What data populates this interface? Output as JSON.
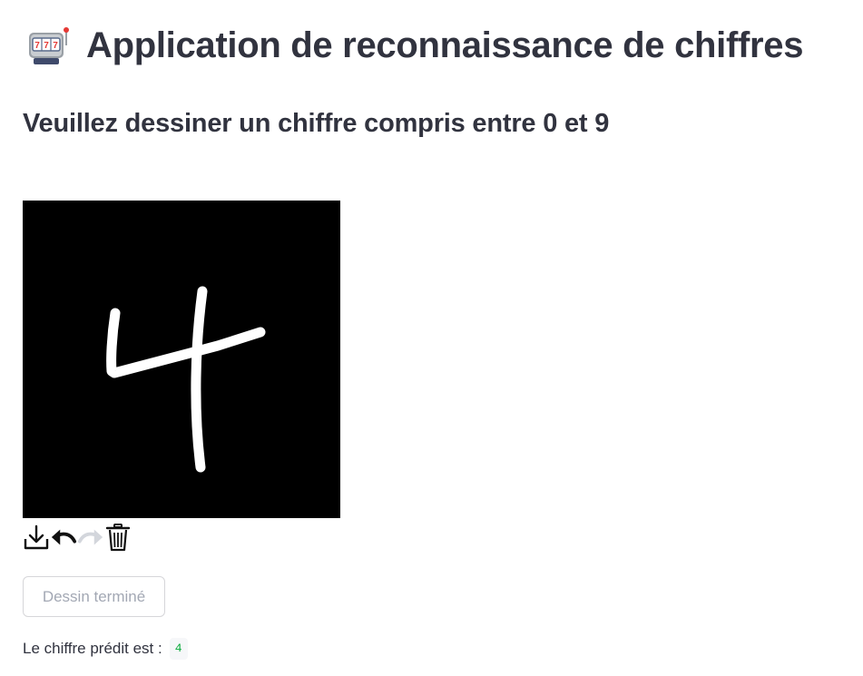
{
  "header": {
    "title_icon": "slot-machine-icon",
    "title": "Application de reconnaissance de chiffres"
  },
  "subheader": "Veuillez dessiner un chiffre compris entre 0 et 9",
  "canvas": {
    "background_color": "#000000",
    "stroke_color": "#ffffff",
    "drawn_digit": "4"
  },
  "toolbar": {
    "icons": [
      "download-icon",
      "undo-icon",
      "redo-icon",
      "trash-icon"
    ]
  },
  "done_button": {
    "label": "Dessin terminé"
  },
  "result": {
    "label": "Le chiffre prédit est :",
    "value": "4"
  },
  "colors": {
    "text": "#31333f",
    "muted": "#a3a8b4",
    "result_value": "#09ab3b"
  }
}
